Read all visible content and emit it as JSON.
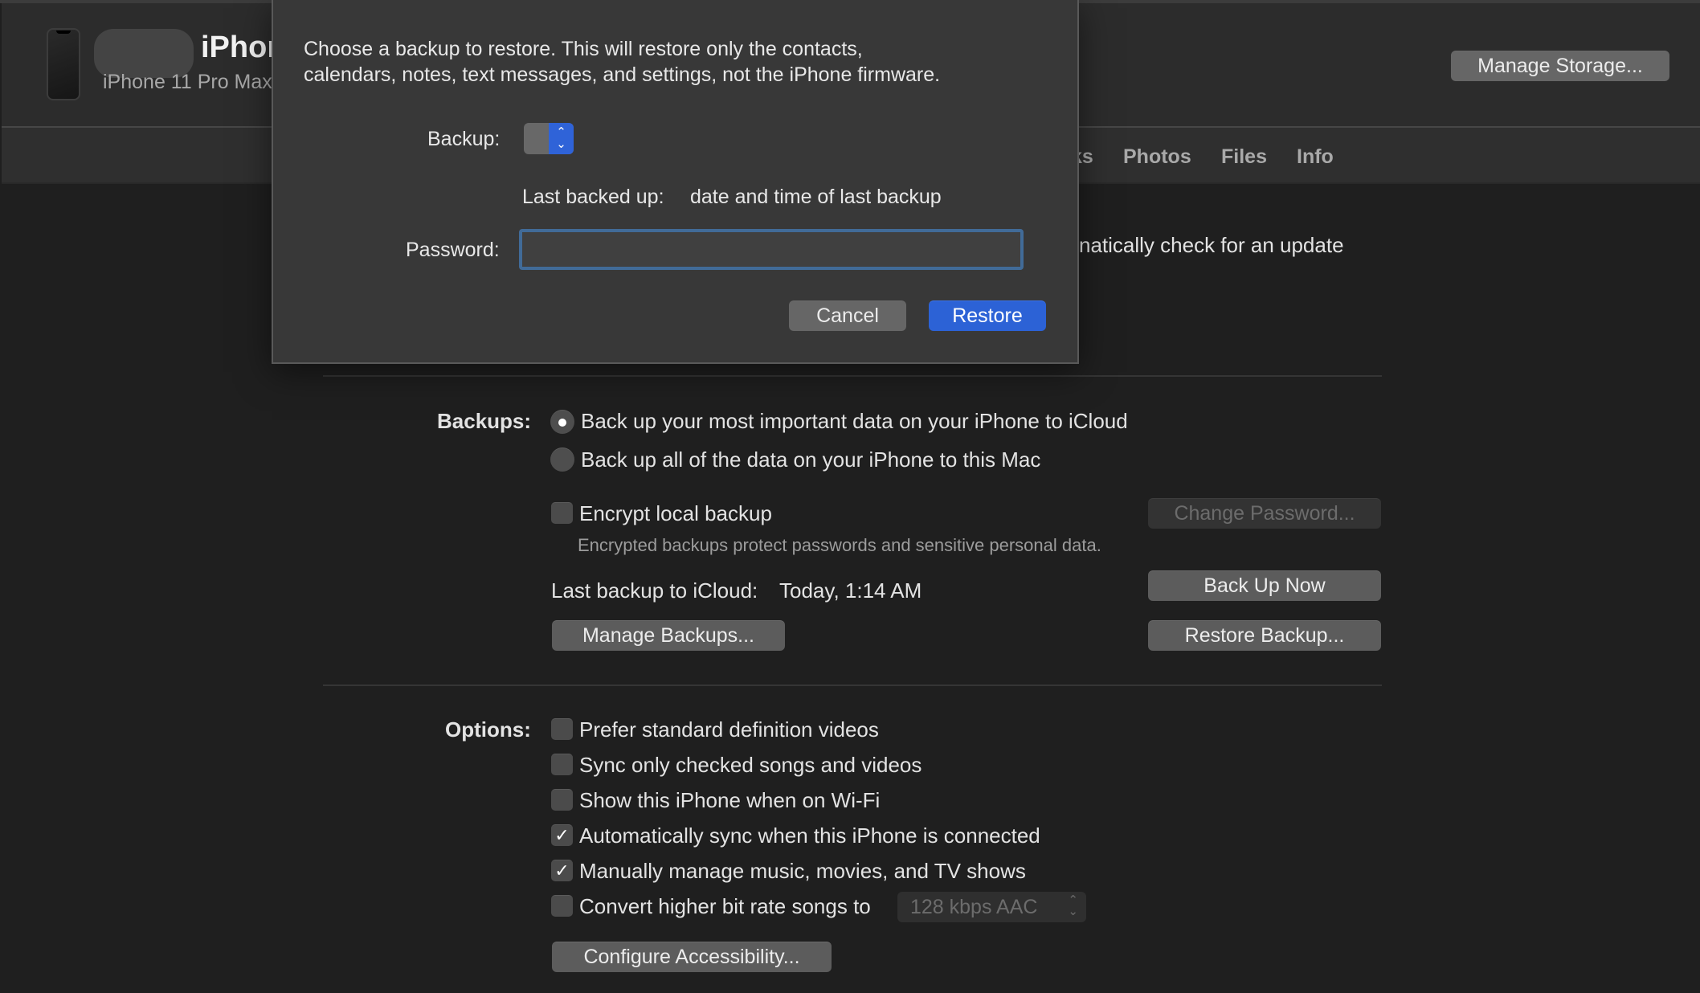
{
  "header": {
    "device_name": "iPhone",
    "device_model": "iPhone 11 Pro Max",
    "manage_storage_label": "Manage Storage..."
  },
  "tabs": [
    {
      "label": "Books",
      "visible_fragment": "ks"
    },
    {
      "label": "Photos"
    },
    {
      "label": "Files"
    },
    {
      "label": "Info"
    }
  ],
  "software": {
    "update_text_fragment": "natically check for an update"
  },
  "backups": {
    "section_label": "Backups:",
    "options": [
      {
        "label": "Back up your most important data on your iPhone to iCloud",
        "selected": true
      },
      {
        "label": "Back up all of the data on your iPhone to this Mac",
        "selected": false
      }
    ],
    "encrypt": {
      "label": "Encrypt local backup",
      "checked": false,
      "note": "Encrypted backups protect passwords and sensitive personal data."
    },
    "change_password_label": "Change Password...",
    "last_backup_label": "Last backup to iCloud:",
    "last_backup_value": "Today, 1:14 AM",
    "back_up_now_label": "Back Up Now",
    "manage_backups_label": "Manage Backups...",
    "restore_backup_label": "Restore Backup..."
  },
  "options": {
    "section_label": "Options:",
    "items": [
      {
        "label": "Prefer standard definition videos",
        "checked": false
      },
      {
        "label": "Sync only checked songs and videos",
        "checked": false
      },
      {
        "label": "Show this iPhone when on Wi-Fi",
        "checked": false
      },
      {
        "label": "Automatically sync when this iPhone is connected",
        "checked": true
      },
      {
        "label": "Manually manage music, movies, and TV shows",
        "checked": true
      },
      {
        "label": "Convert higher bit rate songs to",
        "checked": false
      }
    ],
    "bitrate_value": "128 kbps AAC",
    "configure_accessibility_label": "Configure Accessibility..."
  },
  "dialog": {
    "message_line1": "Choose a backup to restore. This will restore only the contacts,",
    "message_line2": "calendars, notes, text messages, and settings, not the iPhone firmware.",
    "backup_label": "Backup:",
    "backup_value": "",
    "last_backed_up_label": "Last backed up:",
    "last_backed_up_value": "date and time of last backup",
    "password_label": "Password:",
    "password_value": "",
    "cancel_label": "Cancel",
    "restore_label": "Restore",
    "accent_color": "#2c62d6"
  },
  "icons": {
    "check": "✓",
    "popup_arrows": "⌃⌄"
  }
}
